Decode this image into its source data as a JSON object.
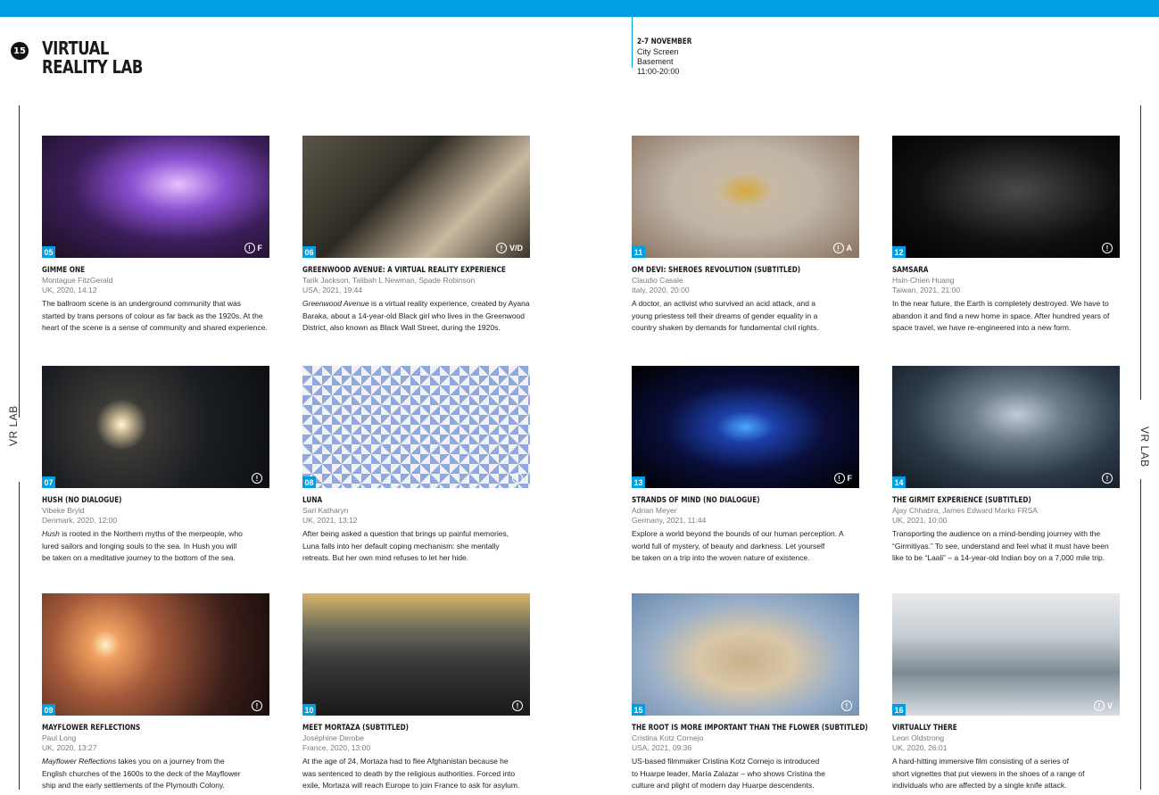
{
  "header": {
    "page_number": "15",
    "title_line1": "VIRTUAL",
    "title_line2": "REALITY LAB",
    "date": "2-7 NOVEMBER",
    "venue": "City Screen",
    "room": "Basement",
    "hours": "11:00-20:00"
  },
  "side_label": "VR LAB",
  "colors": {
    "accent": "#009fe3"
  },
  "films": [
    {
      "num": "05",
      "rating": "F",
      "title": "GIMME ONE",
      "credit": "Montague FitzGerald",
      "meta": "UK, 2020, 14:12",
      "desc": [
        "The ballroom scene is an underground community that was",
        "started by trans persons of colour as far back as the 1920s. At the",
        "heart of the scene is a sense of community and shared experience."
      ]
    },
    {
      "num": "06",
      "rating": "V/D",
      "title": "GREENWOOD AVENUE: A VIRTUAL REALITY EXPERIENCE",
      "credit": "Tarik Jackson, Talibah L Newman, Spade Robinson",
      "meta": "USA, 2021, 19:44",
      "desc_italic": "Greenwood Avenue",
      "desc": [
        " is a virtual reality experience, created by Ayana",
        "Baraka, about a 14-year-old Black girl who lives in the Greenwood",
        "District, also known as Black Wall Street, during the 1920s."
      ]
    },
    {
      "num": "11",
      "rating": "A",
      "title": "OM DEVI: SHEROES REVOLUTION (SUBTITLED)",
      "credit": "Claudio Casale",
      "meta": "Italy, 2020, 20:00",
      "desc": [
        "A doctor, an activist who survived an acid attack, and a",
        "young priestess tell their dreams of gender equality in a",
        "country shaken by demands for fundamental civil rights."
      ]
    },
    {
      "num": "12",
      "rating": "",
      "title": "SAMSARA",
      "credit": "Hsin-Chien Huang",
      "meta": "Taiwan, 2021, 21:00",
      "desc": [
        "In the near future, the Earth is completely destroyed. We have to",
        "abandon it and find a new home in space. After hundred years of",
        "space travel, we have re-engineered into a new form."
      ]
    },
    {
      "num": "07",
      "rating": "",
      "title": "HUSH (NO DIALOGUE)",
      "credit": "Vibeke Bryld",
      "meta": "Denmark, 2020, 12:00",
      "desc_italic": "Hush",
      "desc": [
        " is rooted in the Northern myths of the merpeople, who",
        "lured sailors and longing souls to the sea. In Hush you will",
        "be taken on a meditative journey to the bottom of the sea."
      ]
    },
    {
      "num": "08",
      "rating": "",
      "title": "LUNA",
      "credit": "Sari Katharyn",
      "meta": "UK, 2021, 13:12",
      "desc": [
        "After being asked a question that brings up painful memories,",
        "Luna falls into her default coping mechanism: she mentally",
        "retreats. But her own mind refuses to let her hide."
      ]
    },
    {
      "num": "13",
      "rating": "F",
      "title": "STRANDS OF MIND (NO DIALOGUE)",
      "credit": "Adrian Meyer",
      "meta": "Germany, 2021, 11:44",
      "desc": [
        "Explore a world beyond the bounds of our human perception. A",
        "world full of mystery, of beauty and darkness. Let yourself",
        "be taken on a trip into the woven nature of existence."
      ]
    },
    {
      "num": "14",
      "rating": "",
      "title": "THE GIRMIT EXPERIENCE (SUBTITLED)",
      "credit": "Ajay Chhabra, James Edward Marks FRSA",
      "meta": "UK, 2021, 10:00",
      "desc": [
        "Transporting the audience on a mind-bending journey with the",
        "“Girmitiyas.” To see, understand and feel what it must have been",
        "like to be “Laali” – a 14-year-old Indian boy on a 7,000 mile trip."
      ]
    },
    {
      "num": "09",
      "rating": "",
      "title": "MAYFLOWER REFLECTIONS",
      "credit": "Paul Long",
      "meta": "UK, 2020, 13:27",
      "desc_italic": "Mayflower Reflections",
      "desc": [
        " takes you on a journey from the",
        "English churches of the 1600s to the deck of the Mayflower",
        "ship and the early settlements of the Plymouth Colony."
      ]
    },
    {
      "num": "10",
      "rating": "",
      "title": "MEET MORTAZA (SUBTITLED)",
      "credit": "Joséphine Derobe",
      "meta": "France, 2020, 13:00",
      "desc": [
        "At the age of 24, Mortaza had to flee Afghanistan because he",
        "was sentenced to death by the religious authorities. Forced into",
        "exile, Mortaza will reach Europe to join France to ask for asylum."
      ]
    },
    {
      "num": "15",
      "rating": "",
      "title": "THE ROOT IS MORE IMPORTANT THAN THE FLOWER (SUBTITLED)",
      "credit": "Cristina Kotz Cornejo",
      "meta": "USA, 2021, 09:36",
      "desc": [
        "US-based filmmaker Cristina Kotz Cornejo is introduced",
        "to Huarpe leader, María Zalazar – who shows Cristina the",
        "culture and plight of modern day Huarpe descendents."
      ]
    },
    {
      "num": "16",
      "rating": "V",
      "title": "VIRTUALLY THERE",
      "credit": "Leon Oldstrong",
      "meta": "UK, 2020, 26:01",
      "desc": [
        "A hard-hitting immersive film consisting of a series of",
        "short vignettes that put viewers in the shoes of a range of",
        "individuals who are affected by a single knife attack."
      ]
    }
  ]
}
